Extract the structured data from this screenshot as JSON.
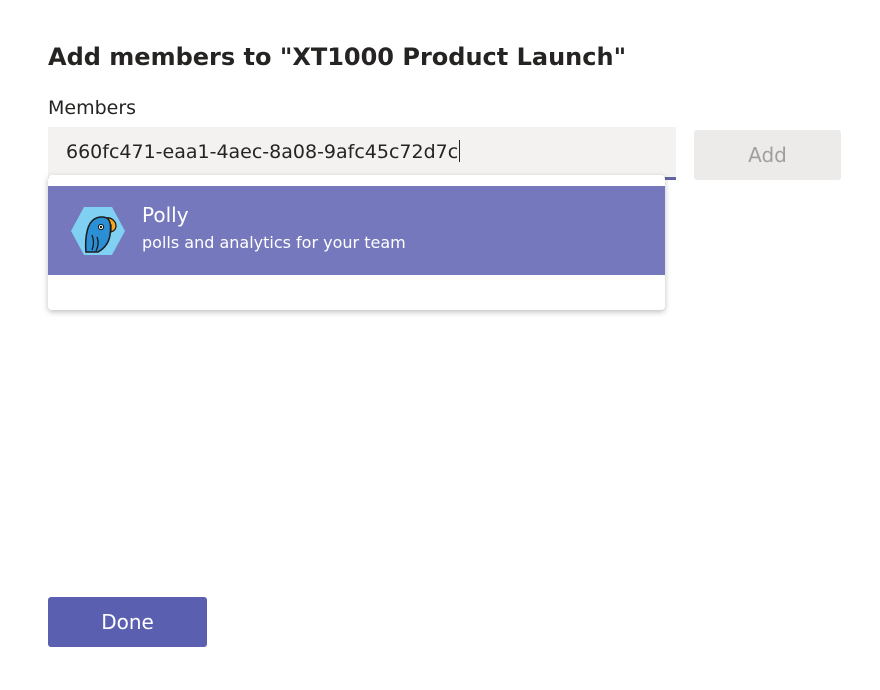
{
  "dialog": {
    "title": "Add members to \"XT1000 Product Launch\"",
    "members_label": "Members",
    "search_value": "660fc471-eaa1-4aec-8a08-9afc45c72d7c",
    "add_label": "Add",
    "done_label": "Done"
  },
  "suggestions": [
    {
      "name": "Polly",
      "description": "polls and analytics for your team",
      "icon": "polly-parrot-icon"
    }
  ],
  "colors": {
    "accent": "#6264a7",
    "done_button": "#5b5fb0",
    "suggestion_highlight": "#7678bd",
    "input_background": "#f3f2f1",
    "disabled_button": "#edebe9"
  }
}
